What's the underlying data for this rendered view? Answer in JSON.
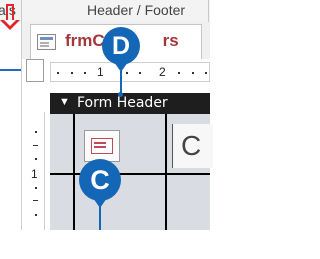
{
  "ribbon": {
    "left_fragment": "als",
    "title": "Header / Footer"
  },
  "document_tab": {
    "title": "frmCustomers",
    "visible_text": "frmC",
    "trailing_text": "rs"
  },
  "ruler": {
    "top_numbers": [
      "1",
      "2"
    ],
    "left_numbers": [
      "1"
    ]
  },
  "form": {
    "section_label": "Form Header",
    "title_fragment": "C"
  },
  "annotations": {
    "callout_d": "D",
    "callout_c": "C"
  },
  "colors": {
    "callout": "#1466b6",
    "arrow": "#e0262a",
    "tab_text": "#a4373a",
    "section_bar": "#1e1e1e",
    "form_background": "#d9dde3"
  },
  "icons": {
    "section_arrow": "down-arrow-icon",
    "form_logo": "form-logo-icon",
    "tab": "form-tab-icon"
  }
}
